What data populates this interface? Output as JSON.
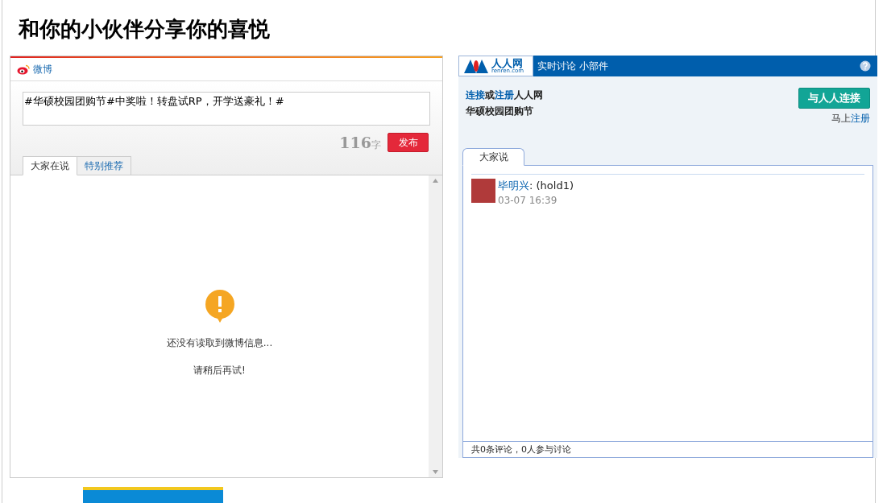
{
  "page_title": "和你的小伙伴分享你的喜悦",
  "weibo": {
    "brand": "微博",
    "post_text": "#华硕校园团购节#中奖啦！转盘试RP，开学送豪礼！#",
    "char_count": "116",
    "char_unit": "字",
    "publish_button": "发布",
    "tabs": [
      {
        "label": "大家在说",
        "selected": true
      },
      {
        "label": "特别推荐",
        "selected": false
      }
    ],
    "empty_message": "还没有读取到微博信息...",
    "retry_message": "请稍后再试!"
  },
  "renren": {
    "logo_text": "人人网",
    "logo_sub": "renren.com",
    "header_title": "实时讨论 小部件",
    "connect_line": {
      "link_1": "连接",
      "middle": "或",
      "link_2": "注册",
      "tail": "人人网"
    },
    "event_name": "华硕校园团购节",
    "connect_button": "与人人连接",
    "signup": {
      "prefix": "马上",
      "link": "注册"
    },
    "tabs": [
      {
        "label": "大家说",
        "selected": true
      }
    ],
    "comments": [
      {
        "author": "毕明兴",
        "text": ": (hold1)",
        "time": "03-07 16:39"
      }
    ],
    "footer": "共0条评论，0人参与讨论"
  }
}
